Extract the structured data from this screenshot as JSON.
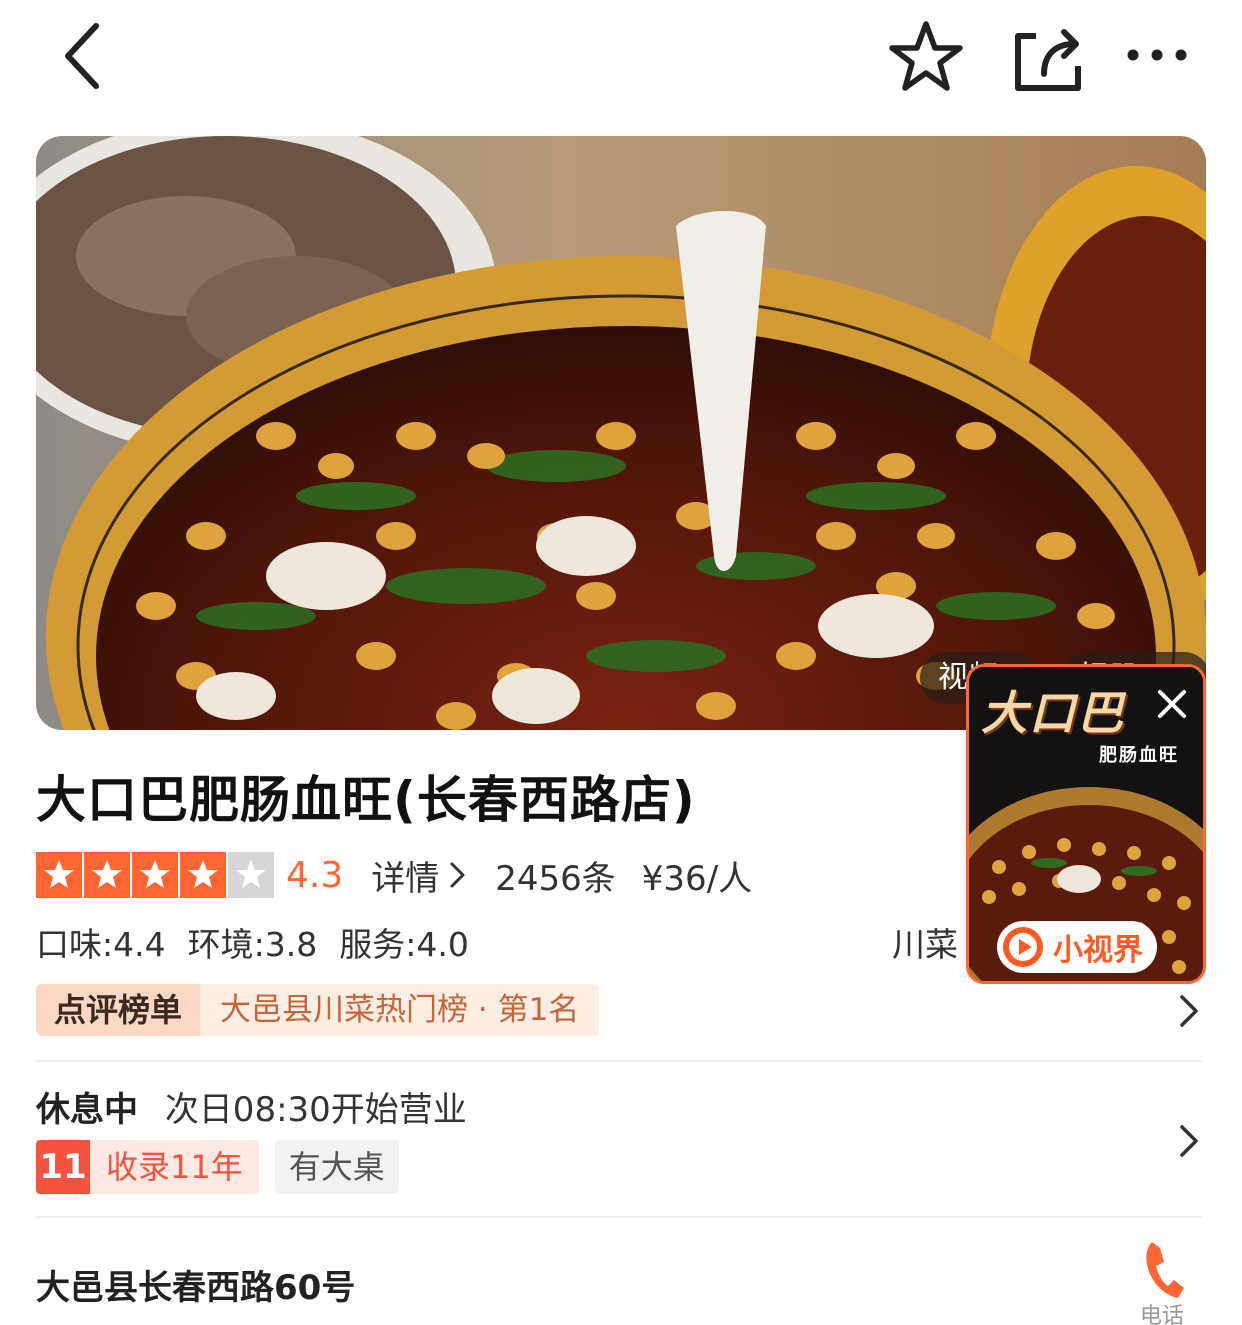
{
  "topbar": {
    "back_icon": "chevron-left-icon",
    "favorite_icon": "star-outline-icon",
    "share_icon": "share-icon",
    "more_icon": "more-dots-icon"
  },
  "hero": {
    "video_label": "视频",
    "album_label": "相册"
  },
  "shop": {
    "name": "大口巴肥肠血旺(长春西路店)",
    "rating_stars": 4.3,
    "score": "4.3",
    "detail_label": "详情",
    "review_count": "2456条",
    "avg_price": "¥36/人",
    "sub_scores": {
      "taste": "口味:4.4",
      "environment": "环境:3.8",
      "service": "服务:4.0"
    },
    "cuisine": "川菜"
  },
  "ranking": {
    "badge": "点评榜单",
    "text": "大邑县川菜热门榜 · 第1名"
  },
  "hours": {
    "status": "休息中",
    "detail": "次日08:30开始营业"
  },
  "tags": {
    "years_num": "11",
    "years_text": "收录11年",
    "table": "有大桌"
  },
  "address": {
    "text": "大邑县长春西路60号",
    "phone_label": "电话"
  },
  "float_video": {
    "brand": "大口巴",
    "subtitle": "肥肠血旺",
    "button": "小视界"
  },
  "colors": {
    "accent": "#ff6633",
    "tag_red": "#f5533d",
    "rank_text": "#c4653a"
  }
}
